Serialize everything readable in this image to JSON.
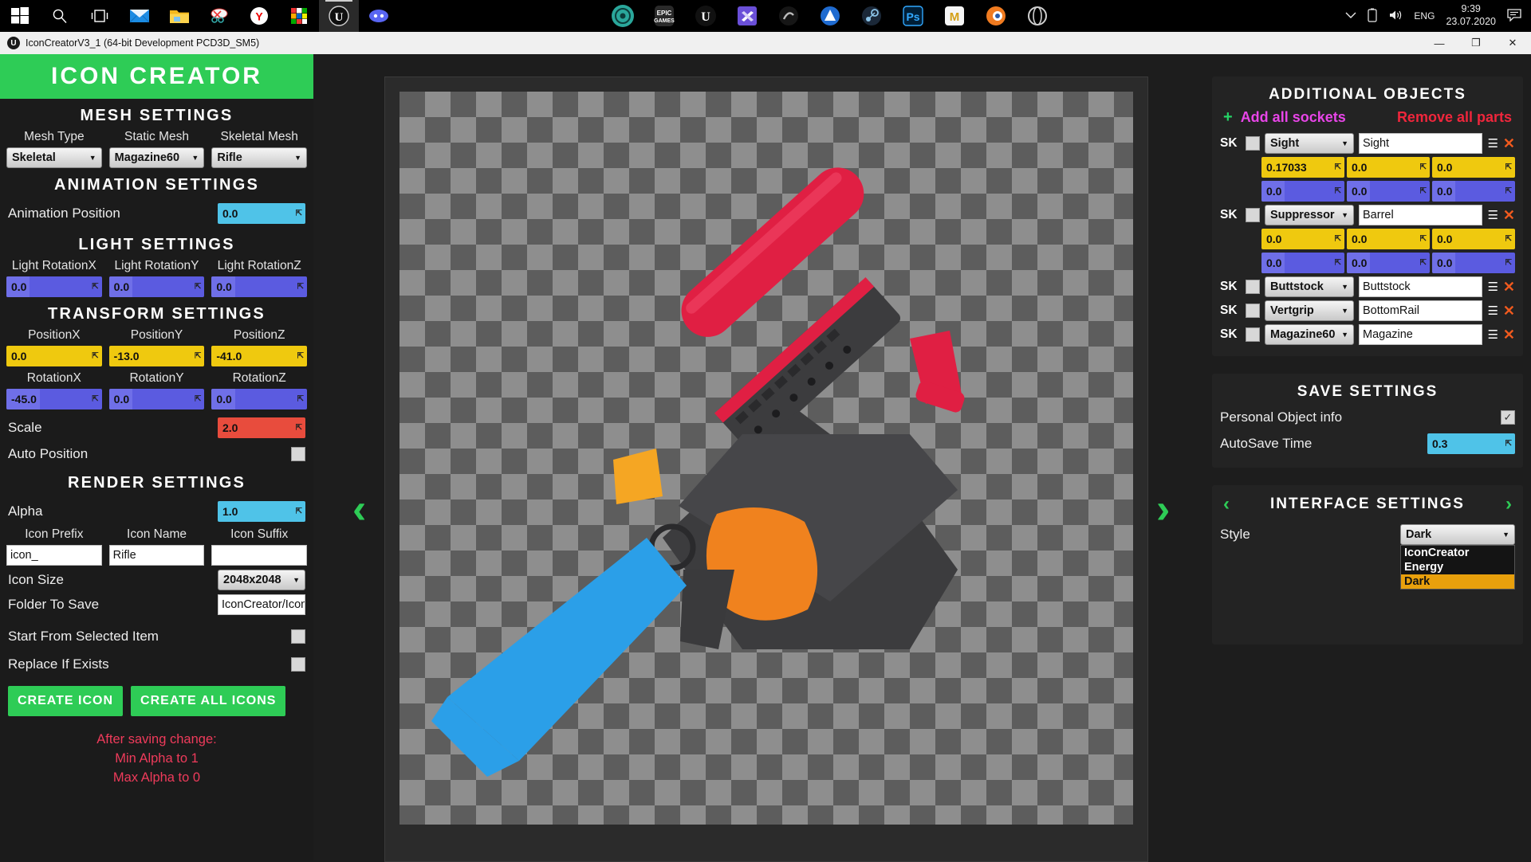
{
  "taskbar": {
    "left_icons": [
      {
        "name": "windows-start-icon",
        "glyph": "start"
      },
      {
        "name": "search-icon",
        "glyph": "search"
      },
      {
        "name": "task-view-icon",
        "glyph": "taskview"
      },
      {
        "name": "mail-icon",
        "glyph": "mail"
      },
      {
        "name": "file-explorer-icon",
        "glyph": "folder"
      },
      {
        "name": "snipping-tool-icon",
        "glyph": "snip"
      },
      {
        "name": "yandex-browser-icon",
        "glyph": "yandex"
      },
      {
        "name": "rubiks-cube-icon",
        "glyph": "cube"
      },
      {
        "name": "unreal-engine-icon",
        "glyph": "unreal"
      },
      {
        "name": "discord-icon",
        "glyph": "discord"
      }
    ],
    "center_icons": [
      {
        "name": "teal-app-icon",
        "glyph": "teal"
      },
      {
        "name": "epic-games-icon",
        "glyph": "epic"
      },
      {
        "name": "unreal-engine-icon",
        "glyph": "unreal2"
      },
      {
        "name": "visual-studio-code-icon",
        "glyph": "vscode"
      },
      {
        "name": "substance-painter-icon",
        "glyph": "substance"
      },
      {
        "name": "affinity-designer-icon",
        "glyph": "affinity"
      },
      {
        "name": "steam-icon",
        "glyph": "steam"
      },
      {
        "name": "photoshop-icon",
        "glyph": "ps"
      },
      {
        "name": "marmoset-icon",
        "glyph": "marmoset"
      },
      {
        "name": "blender-icon",
        "glyph": "blender"
      },
      {
        "name": "cycle-icon",
        "glyph": "cycle"
      }
    ],
    "lang": "ENG",
    "time": "9:39",
    "date": "23.07.2020"
  },
  "titlebar": {
    "title": "IconCreatorV3_1 (64-bit Development PCD3D_SM5)",
    "minimize": "—",
    "maximize": "❐",
    "close": "✕"
  },
  "brand": {
    "name": "ICON CREATOR"
  },
  "mesh_settings": {
    "title": "MESH SETTINGS",
    "fields": [
      {
        "label": "Mesh Type",
        "value": "Skeletal"
      },
      {
        "label": "Static Mesh",
        "value": "Magazine60"
      },
      {
        "label": "Skeletal Mesh",
        "value": "Rifle"
      }
    ]
  },
  "animation_settings": {
    "title": "ANIMATION SETTINGS",
    "position_label": "Animation Position",
    "position_value": "0.0"
  },
  "light_settings": {
    "title": "LIGHT SETTINGS",
    "fields": [
      {
        "label": "Light RotationX",
        "value": "0.0"
      },
      {
        "label": "Light RotationY",
        "value": "0.0"
      },
      {
        "label": "Light RotationZ",
        "value": "0.0"
      }
    ]
  },
  "transform_settings": {
    "title": "TRANSFORM SETTINGS",
    "position": [
      {
        "label": "PositionX",
        "value": "0.0"
      },
      {
        "label": "PositionY",
        "value": "-13.0"
      },
      {
        "label": "PositionZ",
        "value": "-41.0"
      }
    ],
    "rotation": [
      {
        "label": "RotationX",
        "value": "-45.0"
      },
      {
        "label": "RotationY",
        "value": "0.0"
      },
      {
        "label": "RotationZ",
        "value": "0.0"
      }
    ],
    "scale_label": "Scale",
    "scale_value": "2.0",
    "auto_position_label": "Auto Position",
    "auto_position_checked": false
  },
  "render_settings": {
    "title": "RENDER SETTINGS",
    "alpha_label": "Alpha",
    "alpha_value": "1.0",
    "icon_prefix_label": "Icon Prefix",
    "icon_prefix_value": "icon_",
    "icon_name_label": "Icon Name",
    "icon_name_value": "Rifle",
    "icon_suffix_label": "Icon Suffix",
    "icon_suffix_value": "",
    "icon_size_label": "Icon Size",
    "icon_size_value": "2048x2048",
    "folder_label": "Folder To Save",
    "folder_value": "IconCreator/Icon",
    "start_from_selected_label": "Start From Selected Item",
    "start_from_selected_checked": false,
    "replace_if_exists_label": "Replace If Exists",
    "replace_if_exists_checked": false,
    "create_icon_button": "CREATE ICON",
    "create_all_icons_button": "CREATE ALL ICONS",
    "warning_line1": "After saving change:",
    "warning_line2": "Min Alpha to 1",
    "warning_line3": "Max Alpha to 0"
  },
  "viewport": {
    "prev_arrow": "‹",
    "next_arrow": "›"
  },
  "additional_objects": {
    "title": "ADDITIONAL OBJECTS",
    "add_icon": "+",
    "add_all_sockets": "Add all sockets",
    "remove_all_parts": "Remove all parts",
    "rows": [
      {
        "tag": "SK",
        "checked": false,
        "mesh": "Sight",
        "socket": "Sight",
        "expanded": true,
        "pos": [
          "0.17033",
          "0.0",
          "0.0"
        ],
        "rot": [
          "0.0",
          "0.0",
          "0.0"
        ]
      },
      {
        "tag": "SK",
        "checked": false,
        "mesh": "Suppressor",
        "socket": "Barrel",
        "expanded": true,
        "pos": [
          "0.0",
          "0.0",
          "0.0"
        ],
        "rot": [
          "0.0",
          "0.0",
          "0.0"
        ]
      },
      {
        "tag": "SK",
        "checked": false,
        "mesh": "Buttstock",
        "socket": "Buttstock",
        "expanded": false
      },
      {
        "tag": "SK",
        "checked": false,
        "mesh": "Vertgrip",
        "socket": "BottomRail",
        "expanded": false
      },
      {
        "tag": "SK",
        "checked": false,
        "mesh": "Magazine60",
        "socket": "Magazine",
        "expanded": false
      }
    ],
    "menu_icon": "☰",
    "delete_icon": "✕"
  },
  "save_settings": {
    "title": "SAVE SETTINGS",
    "personal_label": "Personal Object info",
    "personal_checked": true,
    "autosave_label": "AutoSave Time",
    "autosave_value": "0.3"
  },
  "interface_settings": {
    "title": "INTERFACE SETTINGS",
    "prev_arrow": "‹",
    "next_arrow": "›",
    "style_label": "Style",
    "style_value": "Dark",
    "style_options": [
      "IconCreator",
      "Energy",
      "Dark"
    ],
    "style_selected_index": 2
  },
  "colors": {
    "brand_green": "#2ecc56",
    "accent_yellow": "#efc90f",
    "accent_blue": "#5b5be0",
    "accent_cyan": "#4fc3e8",
    "accent_red": "#e84c3d",
    "magenta": "#e845e8",
    "orange": "#f05a1e",
    "highlight": "#e8a00c"
  }
}
